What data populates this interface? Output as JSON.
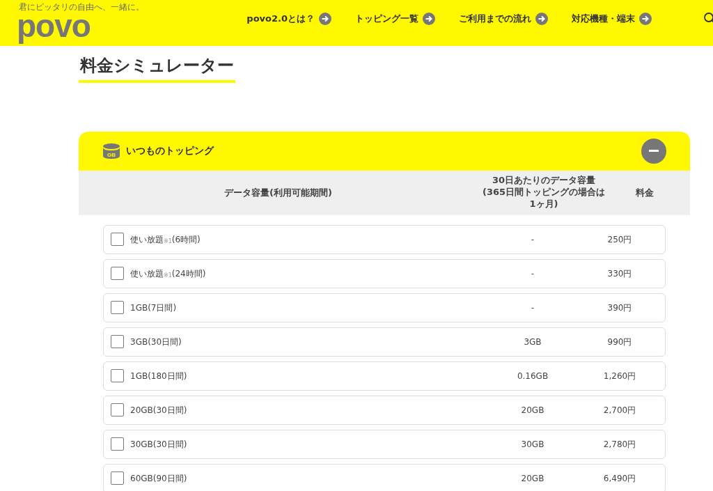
{
  "header": {
    "tagline": "君にピッタリの自由へ、一緒に。",
    "logo": "povo",
    "nav": [
      {
        "label": "povo2.0とは？"
      },
      {
        "label": "トッピング一覧"
      },
      {
        "label": "ご利用までの流れ"
      },
      {
        "label": "対応機種・端末"
      }
    ]
  },
  "page_title": "料金シミュレーター",
  "section": {
    "title": "いつものトッピング",
    "expanded": true,
    "icon_text": "GB",
    "columns": [
      "データ容量(利用可能期間)",
      "30日あたりのデータ容量(365日間トッピングの場合は1ヶ月)",
      "料金"
    ],
    "rows": [
      {
        "name": "使い放題$_{※1}$(6時間)",
        "per30": "-",
        "price": "250円",
        "checked": false
      },
      {
        "name": "使い放題$_{※1}$(24時間)",
        "per30": "-",
        "price": "330円",
        "checked": false
      },
      {
        "name": "1GB(7日間)",
        "per30": "-",
        "price": "390円",
        "checked": false
      },
      {
        "name": "3GB(30日間)",
        "per30": "3GB",
        "price": "990円",
        "checked": false
      },
      {
        "name": "1GB(180日間)",
        "per30": "0.16GB",
        "price": "1,260円",
        "checked": false
      },
      {
        "name": "20GB(30日間)",
        "per30": "20GB",
        "price": "2,700円",
        "checked": false
      },
      {
        "name": "30GB(30日間)",
        "per30": "30GB",
        "price": "2,780円",
        "checked": false
      },
      {
        "name": "60GB(90日間)",
        "per30": "20GB",
        "price": "6,490円",
        "checked": false
      }
    ]
  }
}
